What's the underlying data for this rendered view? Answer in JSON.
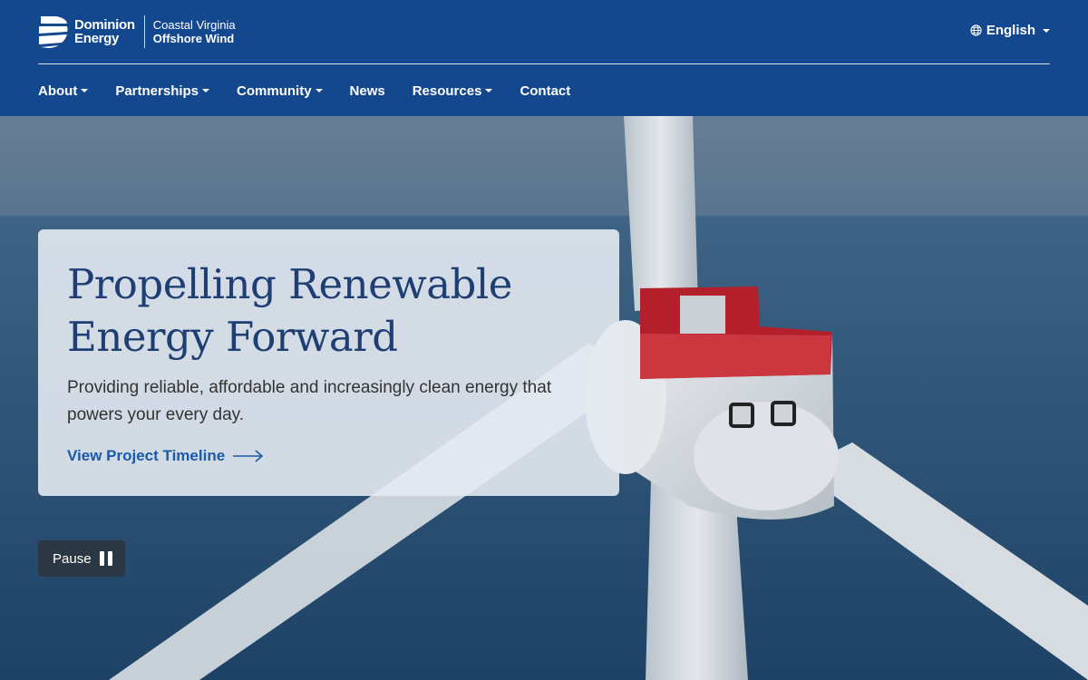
{
  "header": {
    "brand_line1": "Dominion",
    "brand_line2": "Energy",
    "sub_line1": "Coastal Virginia",
    "sub_line2": "Offshore Wind",
    "language_label": "English"
  },
  "nav": {
    "items": [
      {
        "label": "About"
      },
      {
        "label": "Partnerships"
      },
      {
        "label": "Community"
      },
      {
        "label": "News"
      },
      {
        "label": "Resources"
      },
      {
        "label": "Contact"
      }
    ]
  },
  "hero": {
    "title_line1": "Propelling Renewable",
    "title_line2": "Energy Forward",
    "description": "Providing reliable, affordable and increasingly clean energy that powers your every day.",
    "link_label": "View Project Timeline",
    "pause_label": "Pause"
  },
  "colors": {
    "header_bg": "#13488f",
    "accent_link": "#1a5aa6",
    "title": "#1f3f74"
  }
}
